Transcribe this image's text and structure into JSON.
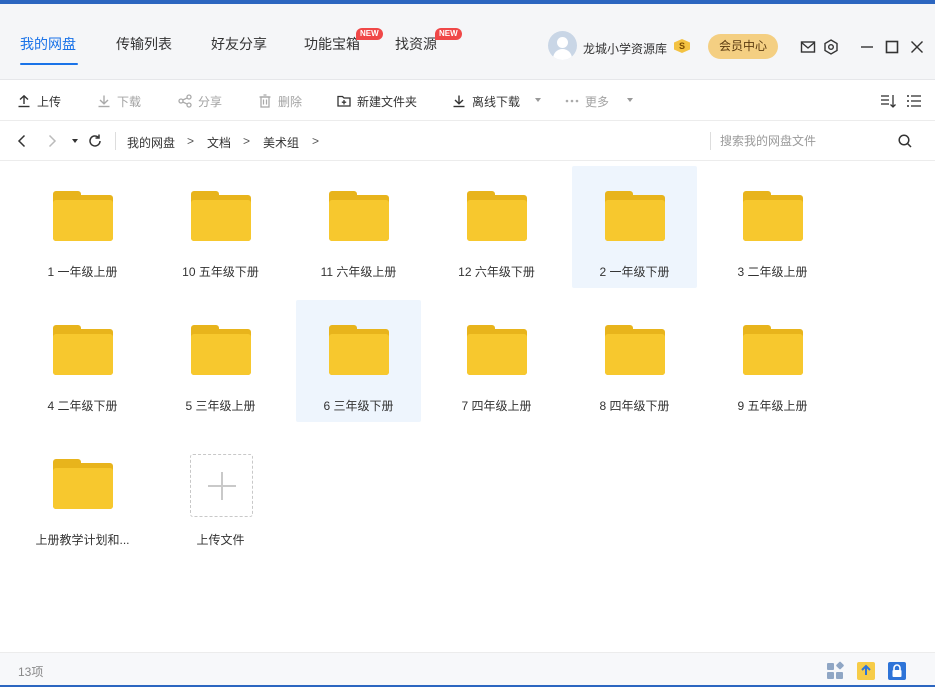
{
  "header": {
    "tabs": [
      {
        "label": "我的网盘",
        "active": true
      },
      {
        "label": "传输列表",
        "active": false
      },
      {
        "label": "好友分享",
        "active": false
      },
      {
        "label": "功能宝箱",
        "active": false,
        "badge": "NEW"
      },
      {
        "label": "找资源",
        "active": false,
        "badge": "NEW"
      }
    ],
    "user": {
      "name": "龙城小学资源库",
      "vip_glyph": "S"
    },
    "vip_center_label": "会员中心",
    "icons": [
      "mail-icon",
      "settings-icon",
      "minimize-icon",
      "maximize-icon",
      "close-icon"
    ]
  },
  "toolbar": {
    "upload": "上传",
    "download": "下载",
    "share": "分享",
    "delete": "删除",
    "new_folder": "新建文件夹",
    "offline_download": "离线下载",
    "more": "更多"
  },
  "nav": {
    "breadcrumbs": [
      "我的网盘",
      "文档",
      "美术组"
    ],
    "separator": ">",
    "search_placeholder": "搜索我的网盘文件"
  },
  "files": [
    {
      "name": "1 一年级上册",
      "selected": false
    },
    {
      "name": "10 五年级下册",
      "selected": false
    },
    {
      "name": "11 六年级上册",
      "selected": false
    },
    {
      "name": "12 六年级下册",
      "selected": false
    },
    {
      "name": "2 一年级下册",
      "selected": true
    },
    {
      "name": "3 二年级上册",
      "selected": false
    },
    {
      "name": "4 二年级下册",
      "selected": false
    },
    {
      "name": "5 三年级上册",
      "selected": false
    },
    {
      "name": "6 三年级下册",
      "selected": true
    },
    {
      "name": "7 四年级上册",
      "selected": false
    },
    {
      "name": "8 四年级下册",
      "selected": false
    },
    {
      "name": "9 五年级上册",
      "selected": false
    },
    {
      "name": "上册教学计划和...",
      "selected": false
    }
  ],
  "upload_tile_label": "上传文件",
  "status": {
    "count": "13项"
  },
  "colors": {
    "accent": "#1a73e8",
    "folder": "#f7c82e",
    "folder_back": "#e8b41c",
    "vip": "#f4cf82",
    "badge": "#f04848",
    "selected_bg": "#eef5fd"
  }
}
